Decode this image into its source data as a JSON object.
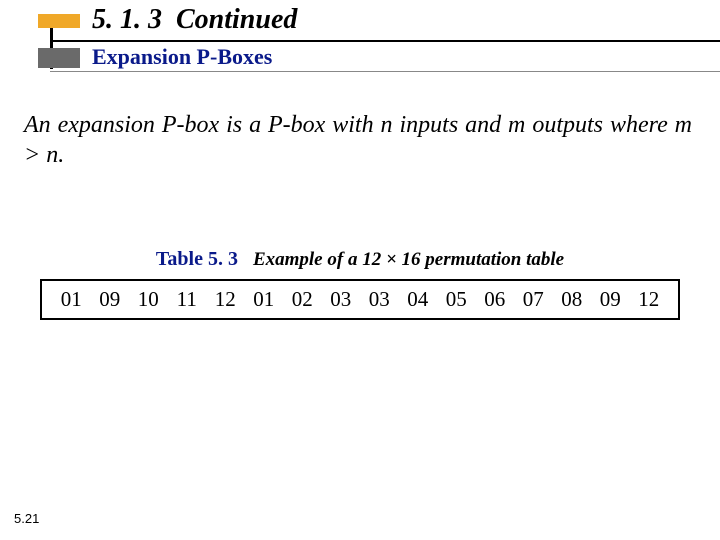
{
  "header": {
    "section_number": "5. 1. 3",
    "continued": "Continued",
    "subtitle": "Expansion P-Boxes"
  },
  "body": {
    "paragraph": "An expansion P-box is a P-box with n inputs and m outputs where m > n."
  },
  "table": {
    "label": "Table  5. 3",
    "caption": "Example of a 12 × 16 permutation table",
    "cells": [
      "01",
      "09",
      "10",
      "11",
      "12",
      "01",
      "02",
      "03",
      "03",
      "04",
      "05",
      "06",
      "07",
      "08",
      "09",
      "12"
    ]
  },
  "page": {
    "number": "5.21"
  }
}
